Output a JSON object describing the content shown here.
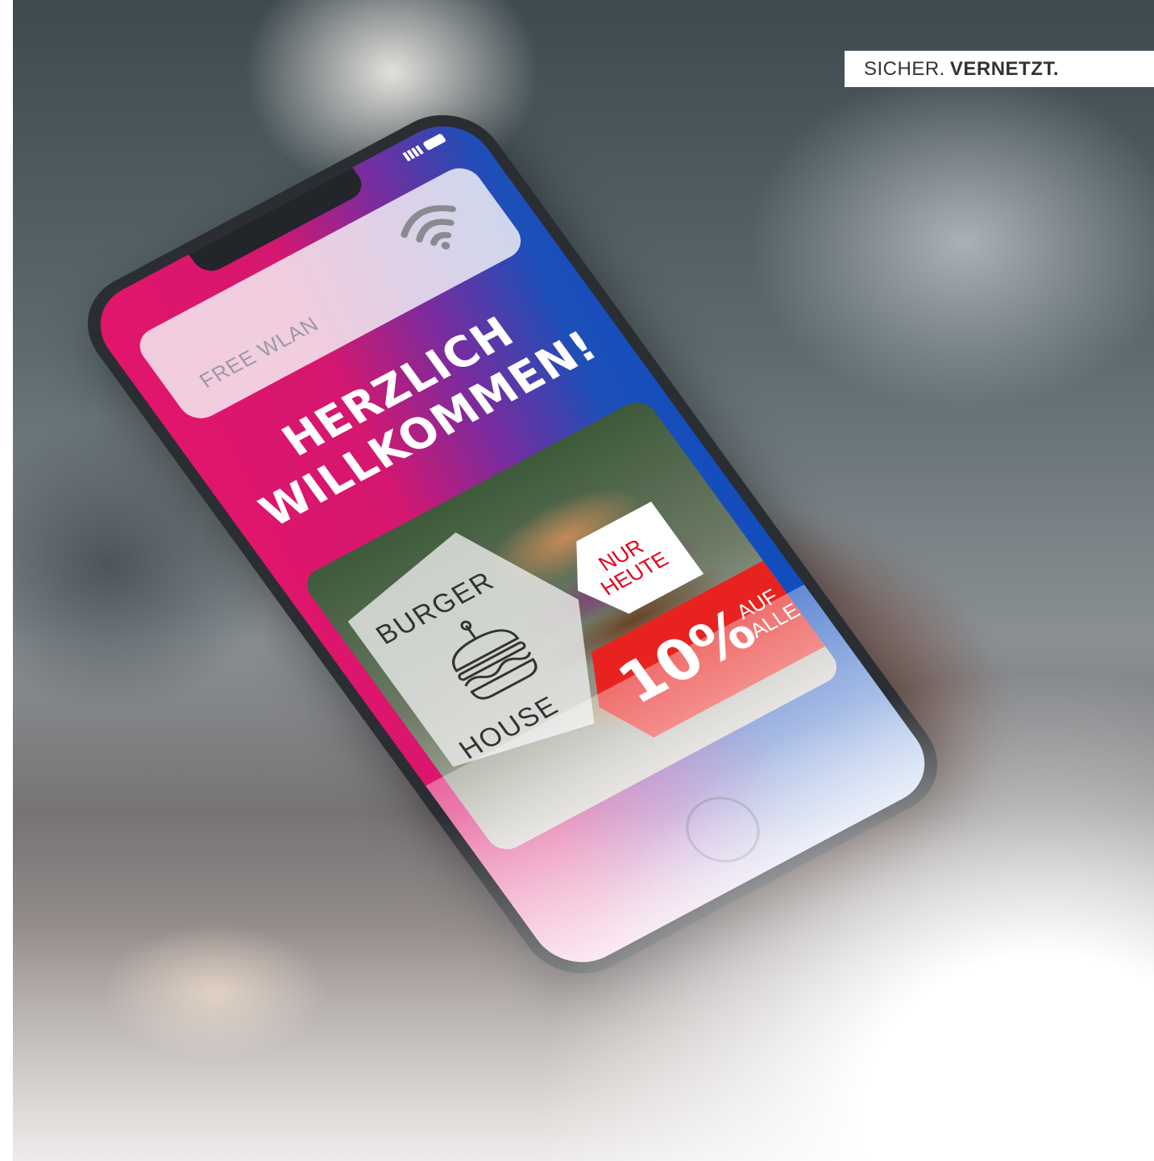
{
  "tagline": {
    "light": "SICHER.",
    "bold": "VERNETZT."
  },
  "phone": {
    "wifi_card": {
      "label": "FREE WLAN",
      "icon": "wifi-icon"
    },
    "welcome": {
      "line1": "HERZLICH",
      "line2": "WILLKOMMEN!"
    },
    "promo": {
      "logo_top": "BURGER",
      "logo_bottom": "HOUSE",
      "logo_icon": "burger-icon",
      "badge_line1": "NUR",
      "badge_line2": "HEUTE",
      "discount": "10%",
      "discount_line1": "AUF",
      "discount_line2": "ALLES!"
    }
  },
  "colors": {
    "magenta": "#e2156b",
    "blue": "#0b4cc0",
    "sale_red": "#e8231f"
  }
}
